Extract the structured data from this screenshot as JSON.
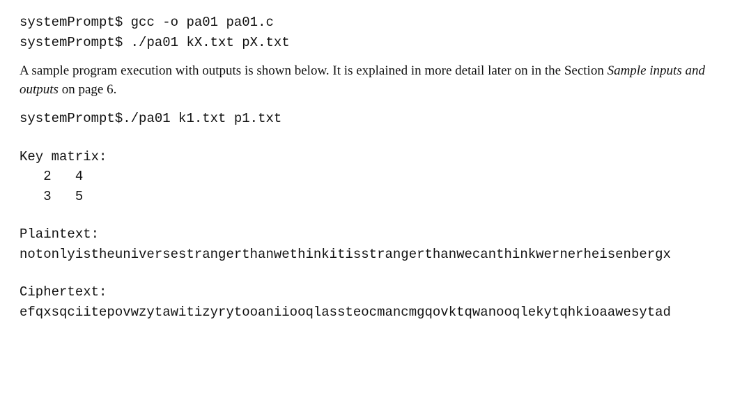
{
  "commands": {
    "line1_prompt": "systemPrompt$ ",
    "line1_cmd": "gcc -o pa01 pa01.c",
    "line2_prompt": "systemPrompt$ ",
    "line2_cmd": "./pa01 kX.txt pX.txt"
  },
  "prose": {
    "lead": "A sample program execution with outputs is shown below. It is explained in more detail later on in the Section ",
    "italic": "Sample inputs and outputs",
    "tail": " on page 6."
  },
  "sample_cmd": {
    "prompt": "systemPrompt$",
    "cmd": "./pa01 k1.txt p1.txt"
  },
  "output": {
    "key_label": "Key matrix:",
    "key_row1": "   2   4",
    "key_row2": "   3   5",
    "plaintext_label": "Plaintext:",
    "plaintext_value": "notonlyistheuniversestrangerthanwethinkitisstrangerthanwecanthinkwernerheisenbergx",
    "ciphertext_label": "Ciphertext:",
    "ciphertext_value": "efqxsqciitepovwzytawitizyrytooaniiooqlassteocmancmgqovktqwanooqlekytqhkioaawesytad"
  }
}
